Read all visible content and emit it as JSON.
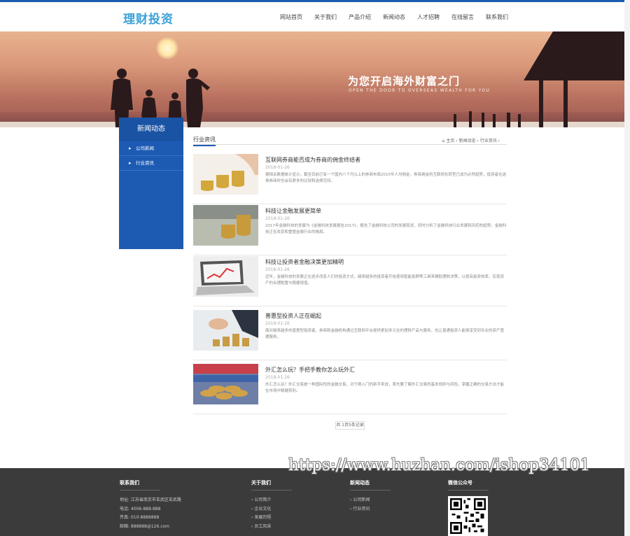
{
  "header": {
    "logo": "理财投资",
    "nav": [
      "网站首页",
      "关于我们",
      "产品介绍",
      "新闻动态",
      "人才招聘",
      "在线留言",
      "联系我们"
    ]
  },
  "banner": {
    "title": "为您开启海外财富之门",
    "subtitle": "OPEN THE DOOR TO OVERSEAS WEALTH FOR YOU"
  },
  "sidebar": {
    "title": "新闻动态",
    "items": [
      "公司新闻",
      "行业资讯"
    ]
  },
  "content": {
    "category": "行业资讯",
    "breadcrumb": "⌂ 主页 › 新闻动态 › 行业资讯 ›",
    "news": [
      {
        "title": "互联网券商能否成为券商的佣金终结者",
        "date": "2018-01-26",
        "desc": "据相关数据统计显示，截至目前已有一个国内八个月以上的券商布局2015年人均佣金，券商佣金的互联网化转型已成为必然趋势，投资者在选择券商时也会有更多的比较和选择空间。"
      },
      {
        "title": "科技让金融发展更简单",
        "date": "2018-01-26",
        "desc": "2017年金融科技的发展为《金融科技发展报告2017》，报告了金融科技公司的发展现状，同时分析了金融科技行业发展和风控的趋势，金融科技正在改变和重塑金融行业的格局。"
      },
      {
        "title": "科技让投资者金融决策更加精明",
        "date": "2018-01-26",
        "desc": "近年，金融科技的发展正在逐步改变人们的投资方式，越来越多的投资者开始使用智能投顾等工具来辅助理财决策，以提高投资效率，实现资产的合理配置与稳健增值。"
      },
      {
        "title": "普惠型投资人正在崛起",
        "date": "2018-01-26",
        "desc": "面对越来越多的普惠型投资者，券商和金融机构通过互联网平台提供更加多元化的理财产品与服务，也让普通投资人能够享受到专业的资产管理服务。"
      },
      {
        "title": "外汇怎么玩？手把手教你怎么玩外汇",
        "date": "2018-01-26",
        "desc": "外汇怎么玩？外汇交易是一种国际性的金融交易，对于刚入门的新手来说，首先要了解外汇交易的基本规则与风险，掌握正确的交易方法才能在市场中稳健获利。"
      }
    ],
    "pager": "共 1页5条记录"
  },
  "footer": {
    "contact": {
      "title": "联系我们",
      "lines": [
        "地址: 江苏省南京市玄武区玄武路",
        "电话: 4006-888-888",
        "传真: 010-8888888",
        "邮箱: 888888@126.com"
      ]
    },
    "about": {
      "title": "关于我们",
      "links": [
        "公司简介",
        "企业文化",
        "发展历程",
        "员工风采"
      ]
    },
    "news": {
      "title": "新闻动态",
      "links": [
        "公司新闻",
        "行业资讯"
      ]
    },
    "wechat": {
      "title": "微信公众号"
    }
  },
  "watermark": "https://www.huzhan.com/ishop34101",
  "colors": {
    "brand": "#1d5bb3",
    "logo": "#3ba0d8",
    "footer": "#3b3b3b"
  }
}
